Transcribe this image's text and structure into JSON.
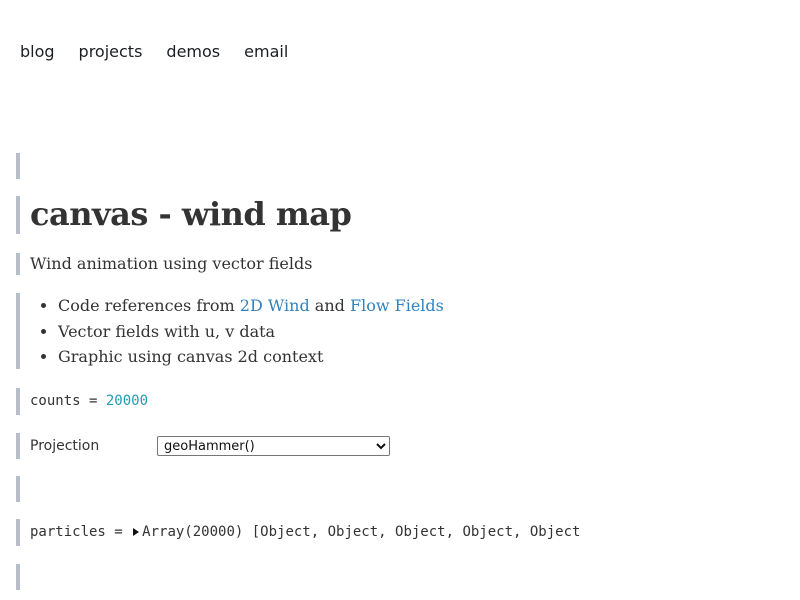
{
  "nav": {
    "items": [
      "blog",
      "projects",
      "demos",
      "email"
    ]
  },
  "page": {
    "title": "canvas - wind map",
    "subtitle": "Wind animation using vector fields",
    "bullets": {
      "b1_prefix": "Code references from ",
      "b1_link1": "2D Wind",
      "b1_mid": " and ",
      "b1_link2": "Flow Fields",
      "b2": "Vector fields with u, v data",
      "b3": "Graphic using canvas 2d context"
    }
  },
  "counts": {
    "name": "counts",
    "op": " = ",
    "value": "20000"
  },
  "projection": {
    "label": "Projection",
    "selected": "geoHammer()"
  },
  "particles": {
    "name": "particles",
    "op": " = ",
    "summary": "Array(20000) [Object, Object, Object, Object, Object"
  },
  "colors": {
    "cell_border": "#b8bdc8",
    "link": "#3182bd",
    "number": "#1f9eb5"
  }
}
